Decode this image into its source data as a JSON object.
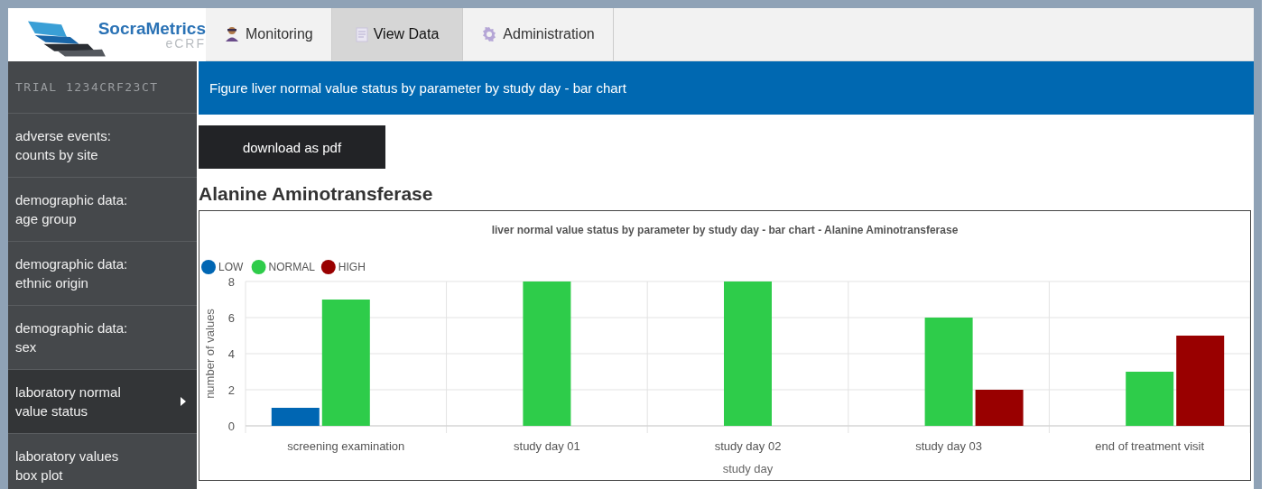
{
  "logo": {
    "name": "SocraMetrics",
    "sub": "eCRF"
  },
  "tabs": [
    {
      "label": "Monitoring",
      "kind": "person",
      "selected": false
    },
    {
      "label": "View Data",
      "kind": "document",
      "selected": true
    },
    {
      "label": "Administration",
      "kind": "gear",
      "selected": false
    }
  ],
  "sidebar": {
    "trial": "TRIAL 1234CRF23CT",
    "items": [
      {
        "lines": [
          "adverse events:",
          "counts by site"
        ],
        "selected": false
      },
      {
        "lines": [
          "demographic data:",
          "age group"
        ],
        "selected": false
      },
      {
        "lines": [
          "demographic data:",
          "ethnic origin"
        ],
        "selected": false
      },
      {
        "lines": [
          "demographic data:",
          "sex"
        ],
        "selected": false
      },
      {
        "lines": [
          "laboratory normal",
          "value status"
        ],
        "selected": true
      },
      {
        "lines": [
          "laboratory values",
          "box plot"
        ],
        "selected": false
      }
    ]
  },
  "page_title": "Figure liver normal value status by parameter by study day - bar chart",
  "download_button": "download as pdf",
  "heading": "Alanine Aminotransferase",
  "chart": {
    "chart_data": {
      "type": "bar",
      "title": "liver normal value status by parameter by study day - bar chart - Alanine Aminotransferase",
      "xlabel": "study day",
      "ylabel": "number of values",
      "categories": [
        "screening examination",
        "study day 01",
        "study day 02",
        "study day 03",
        "end of treatment visit"
      ],
      "series": [
        {
          "name": "LOW",
          "color": "#0066b3",
          "values": [
            1,
            null,
            null,
            null,
            null
          ]
        },
        {
          "name": "NORMAL",
          "color": "#2ecc4a",
          "values": [
            7,
            8,
            8,
            6,
            3
          ]
        },
        {
          "name": "HIGH",
          "color": "#990000",
          "values": [
            null,
            null,
            null,
            2,
            5
          ]
        }
      ],
      "ylim": [
        0,
        8
      ],
      "grid": true,
      "legend": true,
      "yticks": [
        0,
        2,
        4,
        6,
        8
      ]
    }
  }
}
